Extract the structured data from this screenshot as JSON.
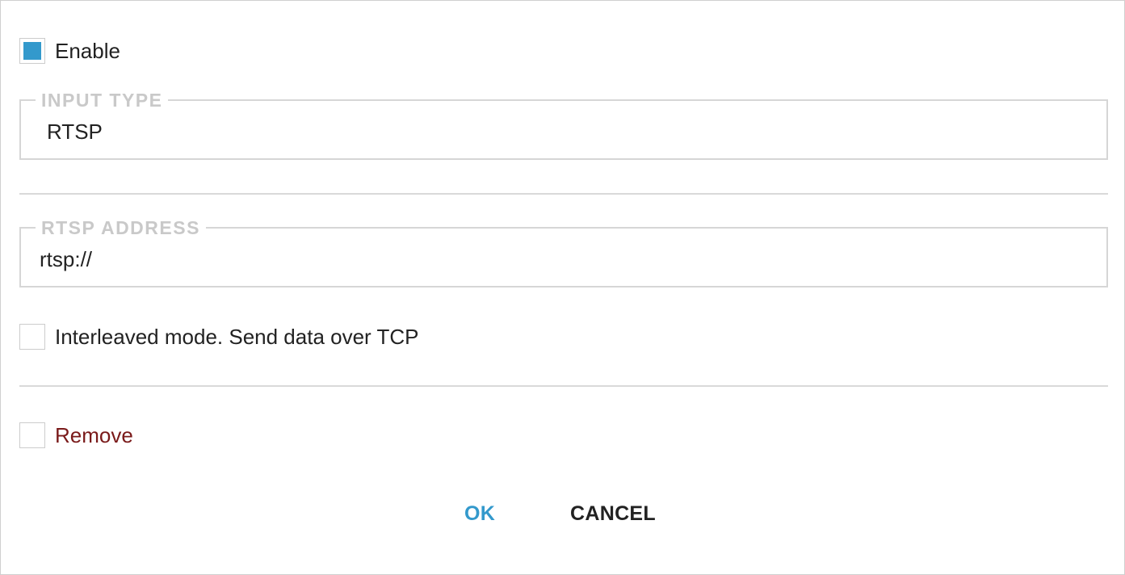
{
  "enable": {
    "label": "Enable",
    "checked": true,
    "accent_color": "#3399cc"
  },
  "input_type": {
    "legend": "INPUT TYPE",
    "value": "RTSP"
  },
  "rtsp_address": {
    "legend": "RTSP ADDRESS",
    "value": "rtsp://"
  },
  "interleaved": {
    "label": "Interleaved mode. Send data over TCP",
    "checked": false
  },
  "remove": {
    "label": "Remove",
    "checked": false,
    "color": "#7a1a1a"
  },
  "actions": {
    "ok_label": "OK",
    "cancel_label": "CANCEL"
  }
}
